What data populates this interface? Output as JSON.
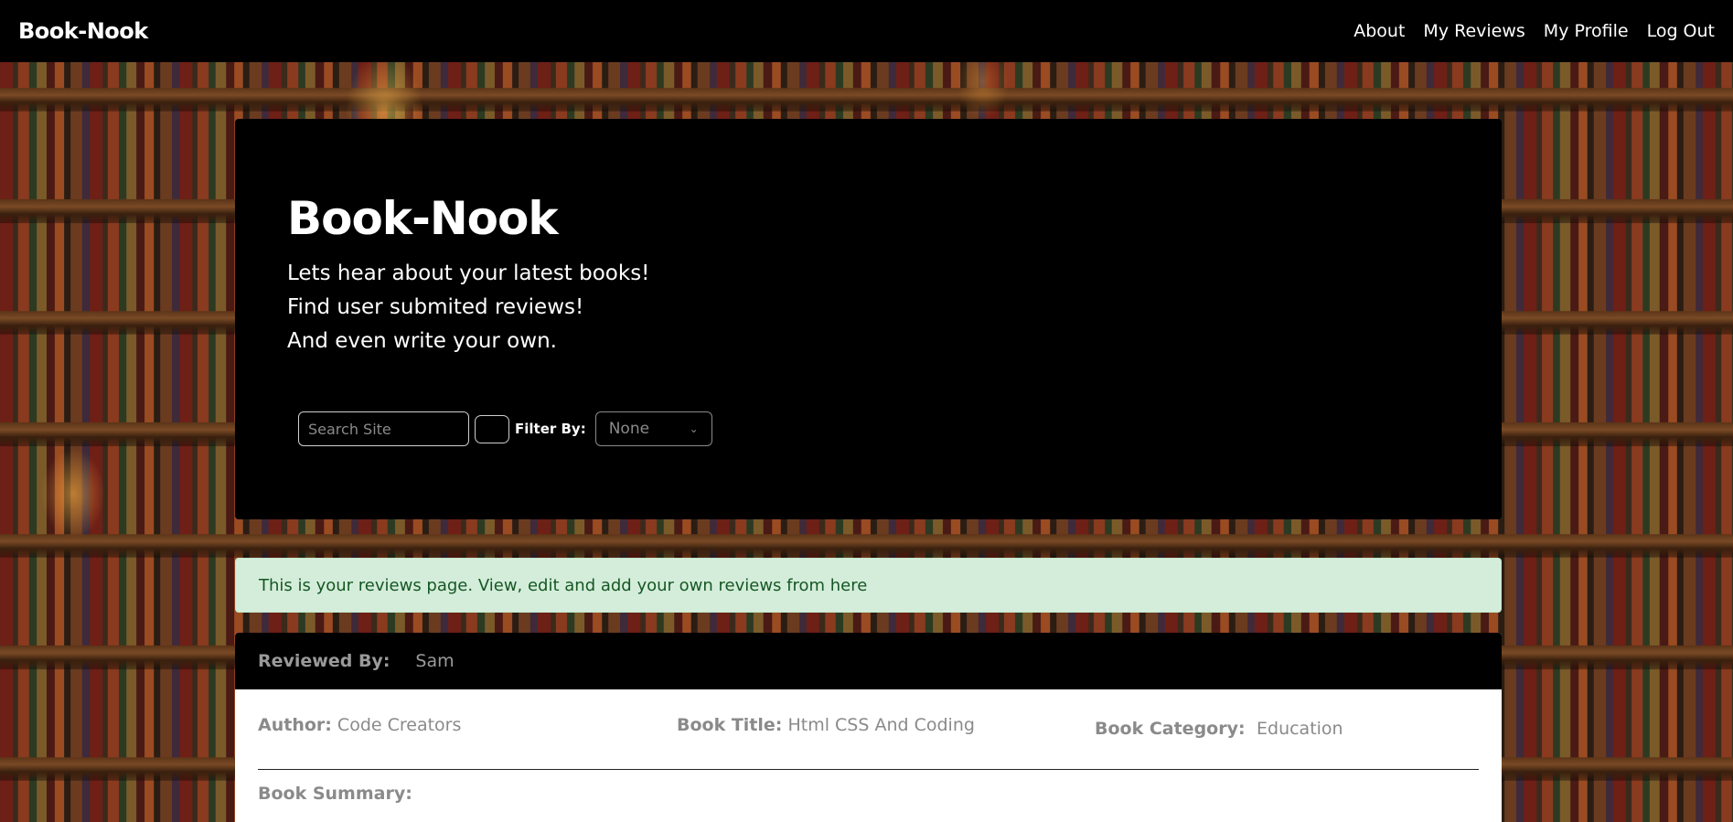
{
  "navbar": {
    "brand": "Book-Nook",
    "links": [
      "About",
      "My Reviews",
      "My Profile",
      "Log Out"
    ]
  },
  "hero": {
    "title": "Book-Nook",
    "lines": [
      "Lets hear about your latest books!",
      "Find user submited reviews!",
      "And even write your own."
    ],
    "search_placeholder": "Search Site",
    "filter_label": "Filter By:",
    "filter_value": "None"
  },
  "alert": {
    "message": "This is your reviews page. View, edit and add your own reviews from here"
  },
  "review": {
    "reviewed_by_label": "Reviewed By:",
    "reviewer": "Sam",
    "author_label": "Author:",
    "author": "Code Creators",
    "title_label": "Book Title:",
    "title": "Html CSS And Coding",
    "category_label": "Book Category:",
    "category": "Education",
    "summary_label": "Book Summary:"
  },
  "colors": {
    "alert_bg": "#d4edda",
    "alert_text": "#155724",
    "header_bg": "#000000"
  }
}
